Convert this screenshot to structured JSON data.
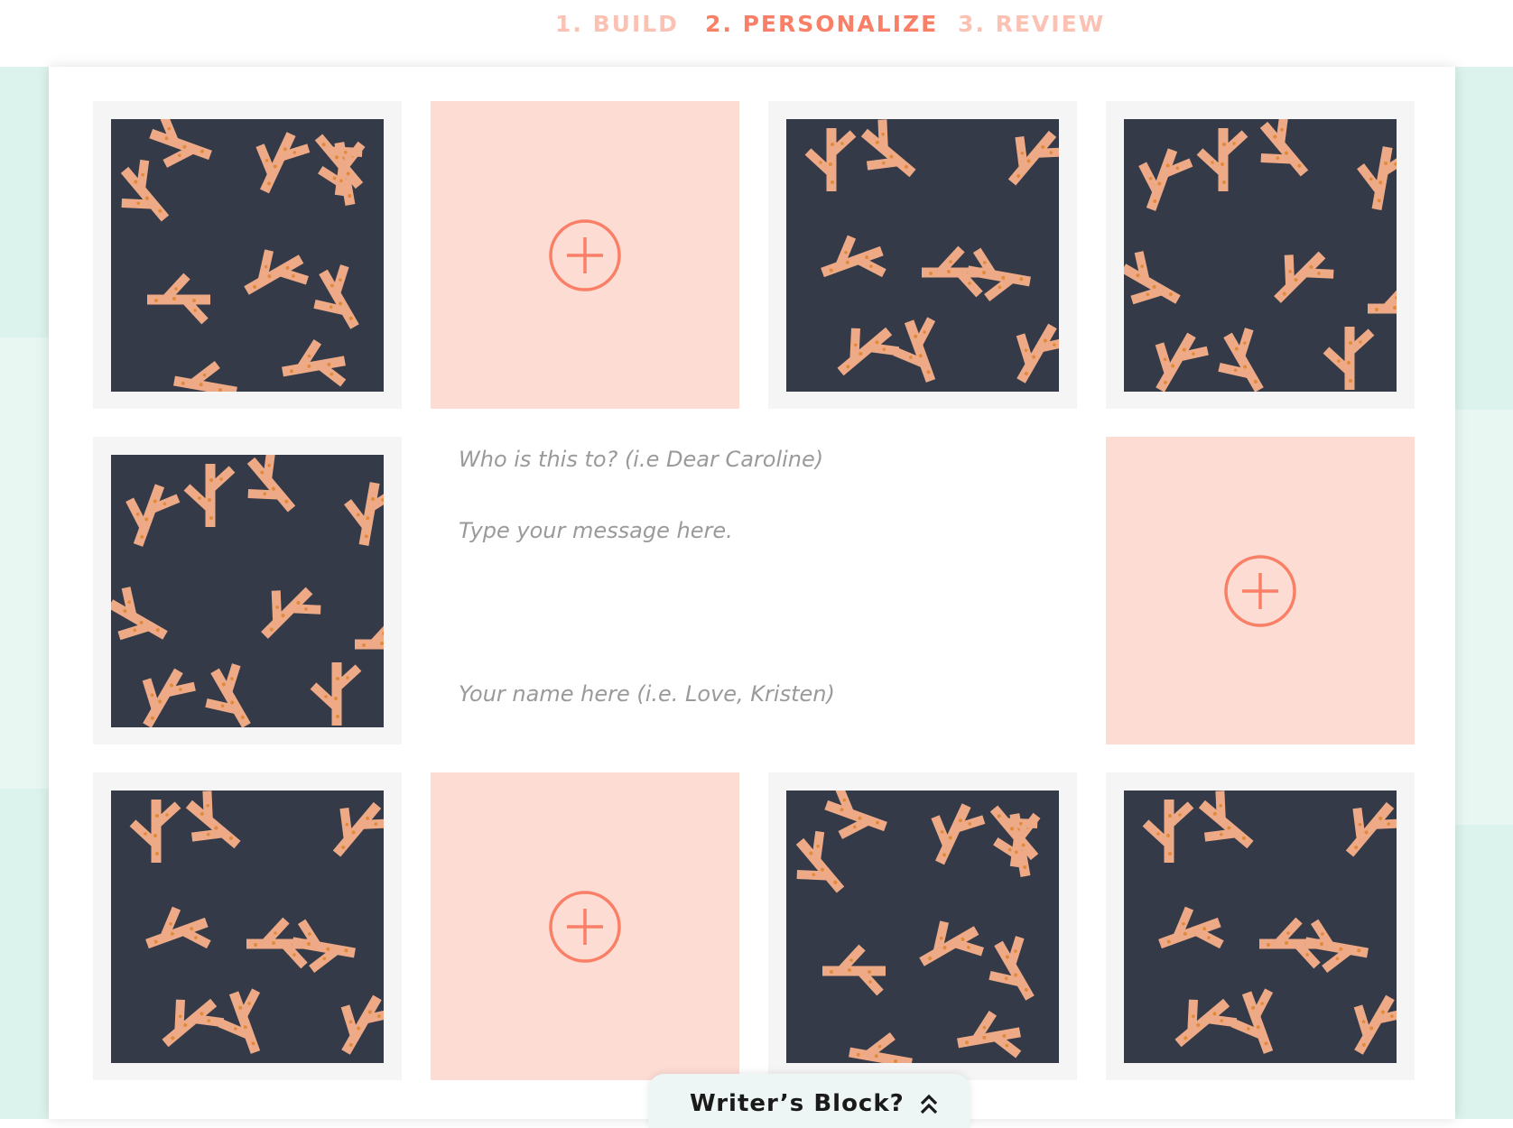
{
  "steps": [
    {
      "label": "1. BUILD",
      "active": false
    },
    {
      "label": "2. PERSONALIZE",
      "active": true
    },
    {
      "label": "3. REVIEW",
      "active": false
    }
  ],
  "message": {
    "recipient_placeholder": "Who is this to? (i.e Dear Caroline)",
    "body_placeholder": "Type your message here.",
    "signature_placeholder": "Your name here (i.e. Love, Kristen)"
  },
  "writers_block": {
    "label": "Writer’s Block?",
    "icon": "double-chevron-up-icon"
  },
  "tiles": [
    {
      "type": "photo",
      "icon": "branch-pattern-image"
    },
    {
      "type": "add",
      "icon": "plus-circle-icon"
    },
    {
      "type": "photo",
      "icon": "branch-pattern-image"
    },
    {
      "type": "photo",
      "icon": "branch-pattern-image"
    },
    {
      "type": "photo",
      "icon": "branch-pattern-image"
    },
    {
      "type": "add",
      "icon": "plus-circle-icon"
    },
    {
      "type": "photo",
      "icon": "branch-pattern-image"
    },
    {
      "type": "add",
      "icon": "plus-circle-icon"
    },
    {
      "type": "photo",
      "icon": "branch-pattern-image"
    },
    {
      "type": "photo",
      "icon": "branch-pattern-image"
    }
  ],
  "colors": {
    "accent": "#f97f66",
    "step_inactive": "#fbc2b4",
    "add_tile": "#fddcd4",
    "pattern_bg": "#343a47",
    "pattern_branch": "#eeaa86",
    "pattern_dot": "#e08a3a",
    "mint": "#dcf2ec"
  }
}
